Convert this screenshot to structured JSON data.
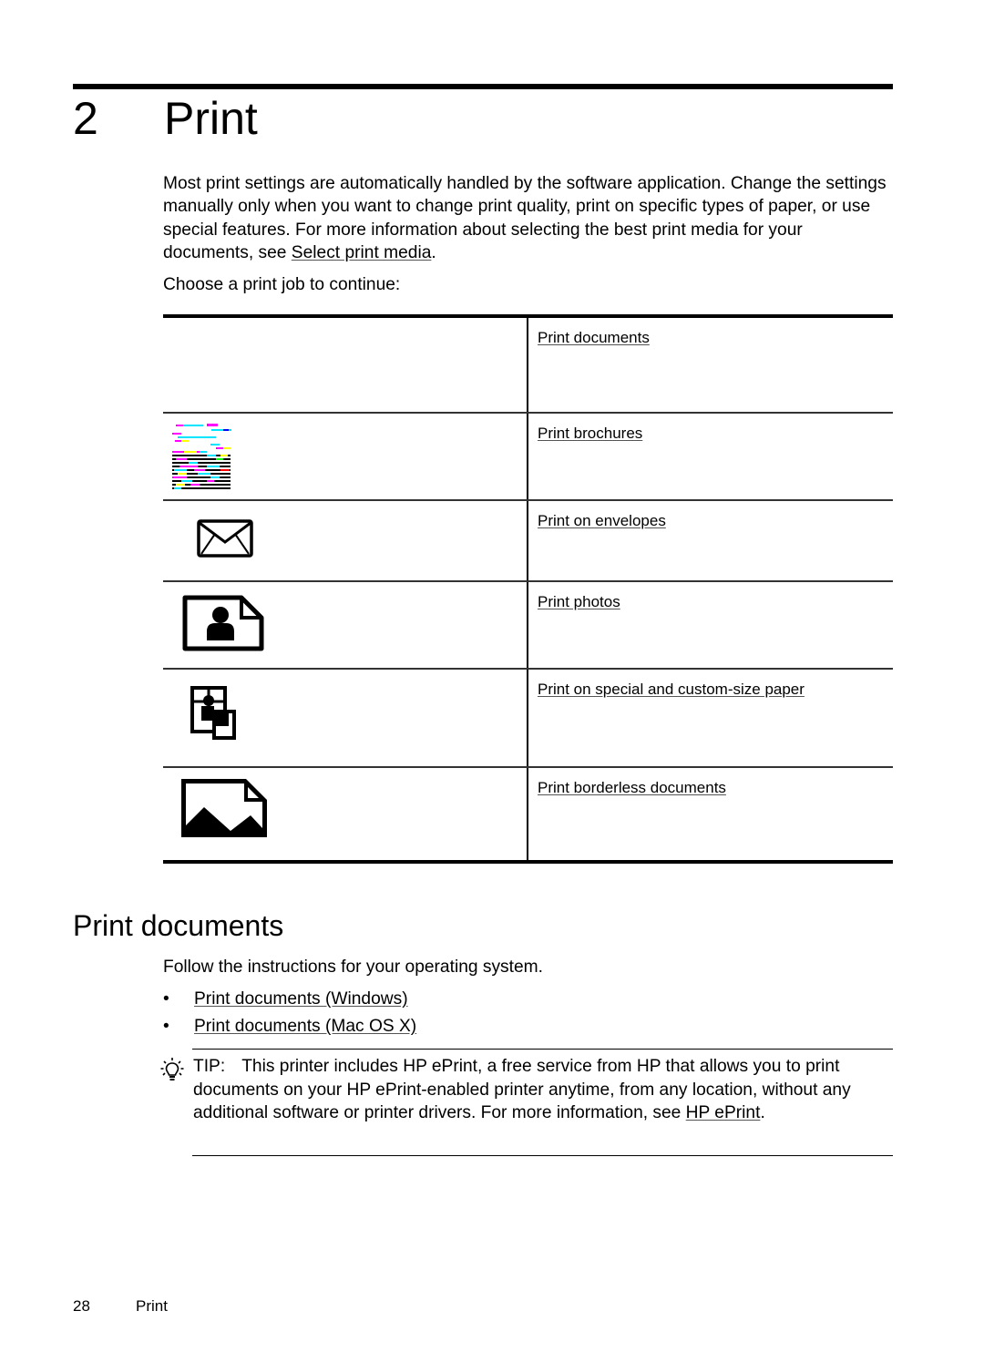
{
  "chapter": {
    "number": "2",
    "title": "Print"
  },
  "intro": {
    "text": "Most print settings are automatically handled by the software application. Change the settings manually only when you want to change print quality, print on specific types of paper, or use special features. For more information about selecting the best print media for your documents, see ",
    "link": "Select print media",
    "after": "."
  },
  "choose_label": "Choose a print job to continue:",
  "print_jobs": [
    {
      "icon": "none",
      "label": "Print documents"
    },
    {
      "icon": "brochure-icon",
      "label": "Print brochures"
    },
    {
      "icon": "envelope-icon",
      "label": "Print on envelopes"
    },
    {
      "icon": "photo-icon",
      "label": "Print photos"
    },
    {
      "icon": "custom-size-paper-icon",
      "label": "Print on special and custom-size paper"
    },
    {
      "icon": "borderless-image-icon",
      "label": "Print borderless documents"
    }
  ],
  "section": {
    "title": "Print documents",
    "instruction": "Follow the instructions for your operating system.",
    "bullet": "•",
    "links": [
      "Print documents (Windows)",
      "Print documents (Mac OS X)"
    ]
  },
  "tip": {
    "icon": "lightbulb-icon",
    "label": "TIP:",
    "text": "This printer includes HP ePrint, a free service from HP that allows you to print documents on your HP ePrint-enabled printer anytime, from any location, without any additional software or printer drivers. For more information, see ",
    "link": "HP ePrint",
    "after": "."
  },
  "footer": {
    "page_number": "28",
    "chapter": "Print"
  }
}
